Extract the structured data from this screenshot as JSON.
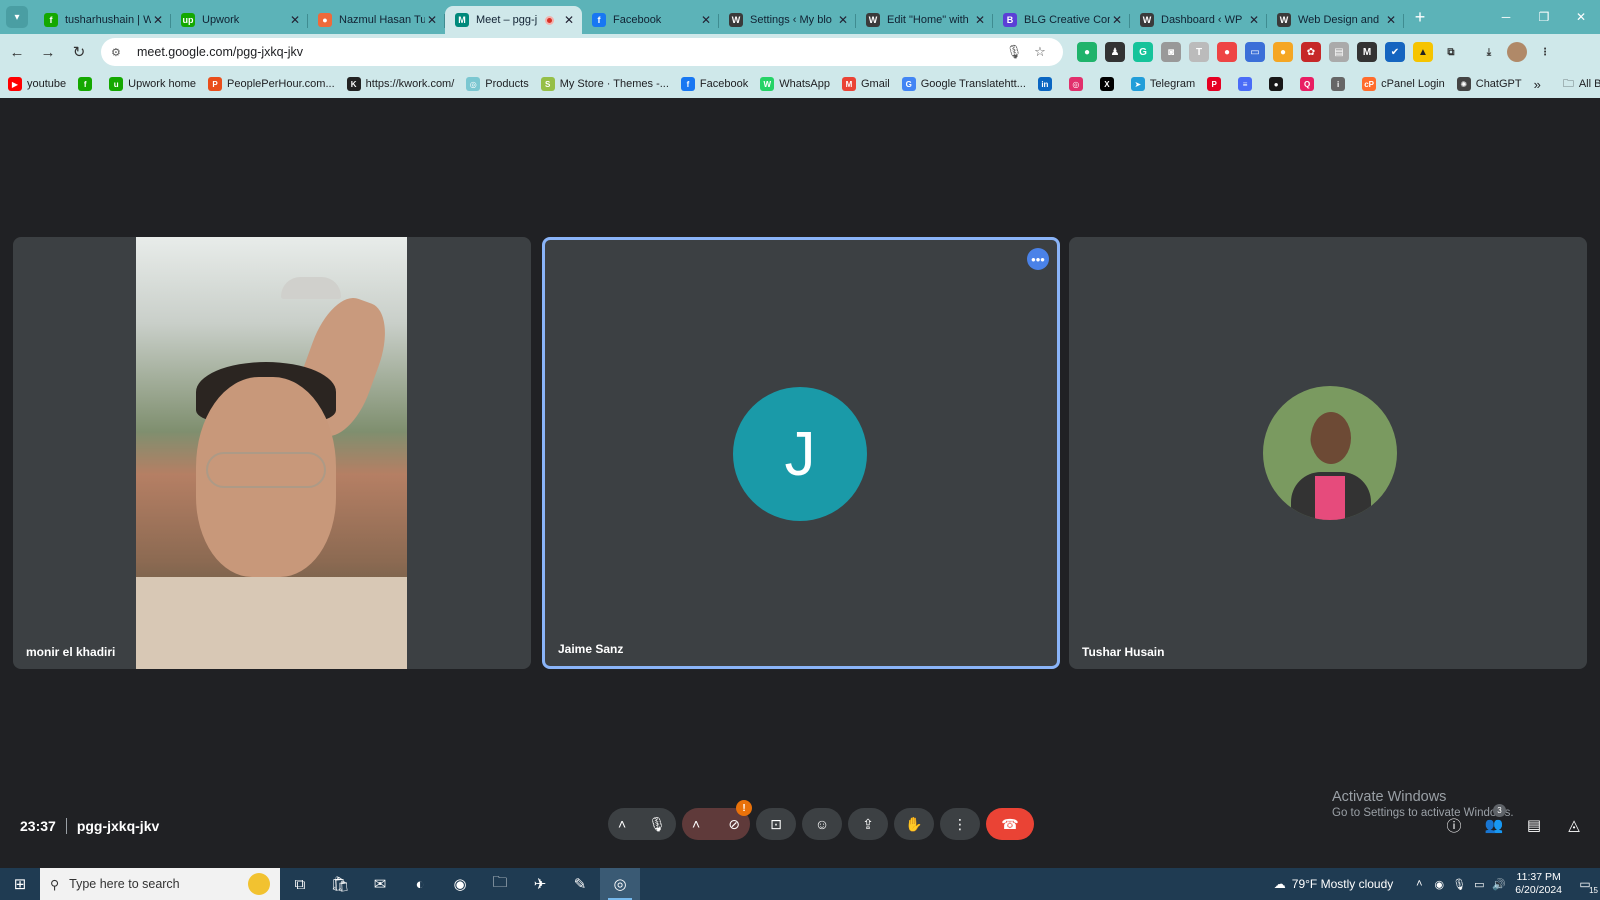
{
  "browser": {
    "tabs": [
      {
        "title": "tusharhushain | W",
        "fav_color": "#14a800",
        "fav_glyph": "f",
        "active": false
      },
      {
        "title": "Upwork",
        "fav_color": "#14a800",
        "fav_glyph": "up",
        "active": false
      },
      {
        "title": "Nazmul Hasan Tu",
        "fav_color": "#ef6a3a",
        "fav_glyph": "●",
        "active": false
      },
      {
        "title": "Meet – pgg-j",
        "fav_color": "#00897b",
        "fav_glyph": "M",
        "active": true
      },
      {
        "title": "Facebook",
        "fav_color": "#1877f2",
        "fav_glyph": "f",
        "active": false
      },
      {
        "title": "Settings ‹ My blo",
        "fav_color": "#3a3a3a",
        "fav_glyph": "W",
        "active": false
      },
      {
        "title": "Edit \"Home\" with",
        "fav_color": "#3a3a3a",
        "fav_glyph": "W",
        "active": false
      },
      {
        "title": "BLG Creative Con",
        "fav_color": "#5b3fd6",
        "fav_glyph": "B",
        "active": false
      },
      {
        "title": "Dashboard ‹ WP",
        "fav_color": "#3a3a3a",
        "fav_glyph": "W",
        "active": false
      },
      {
        "title": "Web Design and",
        "fav_color": "#3a3a3a",
        "fav_glyph": "W",
        "active": false
      }
    ],
    "url": "meet.google.com/pgg-jxkq-jkv",
    "bookmarks": [
      {
        "label": "youtube",
        "color": "#ff0000",
        "glyph": "▶"
      },
      {
        "label": "",
        "color": "#14a800",
        "glyph": "f"
      },
      {
        "label": "Upwork home",
        "color": "#14a800",
        "glyph": "u"
      },
      {
        "label": "PeoplePerHour.com...",
        "color": "#e94e1b",
        "glyph": "P"
      },
      {
        "label": "https://kwork.com/",
        "color": "#222222",
        "glyph": "K"
      },
      {
        "label": "Products",
        "color": "#7bc7d1",
        "glyph": "◎"
      },
      {
        "label": "My Store · Themes -...",
        "color": "#95bf47",
        "glyph": "S"
      },
      {
        "label": "Facebook",
        "color": "#1877f2",
        "glyph": "f"
      },
      {
        "label": "WhatsApp",
        "color": "#25d366",
        "glyph": "W"
      },
      {
        "label": "Gmail",
        "color": "#ea4335",
        "glyph": "M"
      },
      {
        "label": "Google Translatehtt...",
        "color": "#4285f4",
        "glyph": "G"
      },
      {
        "label": "",
        "color": "#0a66c2",
        "glyph": "in"
      },
      {
        "label": "",
        "color": "#e1306c",
        "glyph": "◎"
      },
      {
        "label": "",
        "color": "#000000",
        "glyph": "X"
      },
      {
        "label": "Telegram",
        "color": "#229ed9",
        "glyph": "➤"
      },
      {
        "label": "",
        "color": "#e60023",
        "glyph": "P"
      },
      {
        "label": "",
        "color": "#4a6cf7",
        "glyph": "≡"
      },
      {
        "label": "",
        "color": "#181717",
        "glyph": "●"
      },
      {
        "label": "",
        "color": "#e91e63",
        "glyph": "Q"
      },
      {
        "label": "",
        "color": "#666666",
        "glyph": "i"
      },
      {
        "label": "cPanel Login",
        "color": "#ff6c2c",
        "glyph": "cP"
      },
      {
        "label": "ChatGPT",
        "color": "#444444",
        "glyph": "✺"
      }
    ],
    "all_bookmarks": "All Bookmarks"
  },
  "meet": {
    "participants": [
      {
        "name": "monir el khadiri",
        "type": "video"
      },
      {
        "name": "Jaime Sanz",
        "type": "initial",
        "initial": "J",
        "speaking": true
      },
      {
        "name": "Tushar Husain",
        "type": "photo"
      }
    ],
    "time": "23:37",
    "code": "pgg-jxkq-jkv",
    "camera_alert_badge": "!",
    "participants_count": "3"
  },
  "watermark": {
    "title": "Activate Windows",
    "subtitle": "Go to Settings to activate Windows."
  },
  "taskbar": {
    "search_placeholder": "Type here to search",
    "weather": "79°F  Mostly cloudy",
    "time": "11:37 PM",
    "date": "6/20/2024",
    "notifications": "15"
  }
}
